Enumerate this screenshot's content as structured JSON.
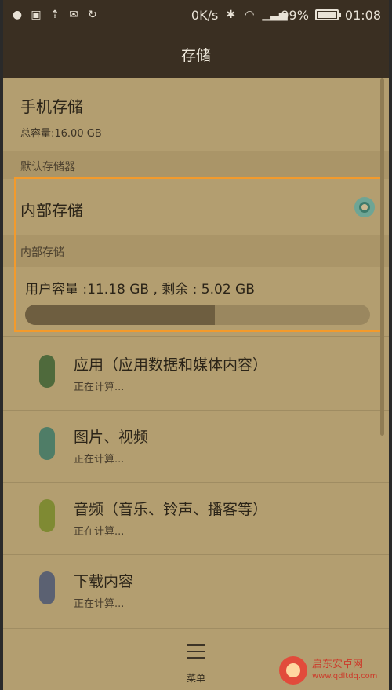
{
  "status_bar": {
    "network_speed": "0K/s",
    "battery_percent": "99%",
    "time": "01:08",
    "battery_level": 0.99,
    "left_icons": [
      "message-icon",
      "image-icon",
      "upload-icon",
      "mail-icon",
      "sync-icon"
    ],
    "right_icons": [
      "bluetooth-icon",
      "wifi-icon",
      "signal-icon",
      "battery-icon"
    ]
  },
  "header": {
    "title": "存储"
  },
  "phone_storage": {
    "title": "手机存储",
    "total": "总容量:16.00 GB"
  },
  "default_storage": {
    "header": "默认存储器",
    "option_label": "内部存储",
    "selected": true
  },
  "internal_storage": {
    "header": "内部存储",
    "capacity_text": "用户容量 :11.18 GB , 剩余 : 5.02 GB",
    "used_fraction": 0.551
  },
  "categories": [
    {
      "title": "应用（应用数据和媒体内容）",
      "status": "正在计算...",
      "color": "#4f6a3c"
    },
    {
      "title": "图片、视频",
      "status": "正在计算...",
      "color": "#4f7d67"
    },
    {
      "title": "音频（音乐、铃声、播客等）",
      "status": "正在计算...",
      "color": "#7f8a33"
    },
    {
      "title": "下载内容",
      "status": "正在计算...",
      "color": "#5b6172"
    }
  ],
  "bottom": {
    "menu_label": "菜单"
  },
  "watermark": {
    "name": "启东安卓网",
    "url": "www.qdltdq.com"
  },
  "colors": {
    "highlight": "#f39a2b",
    "accent": "#3d7a6b"
  }
}
